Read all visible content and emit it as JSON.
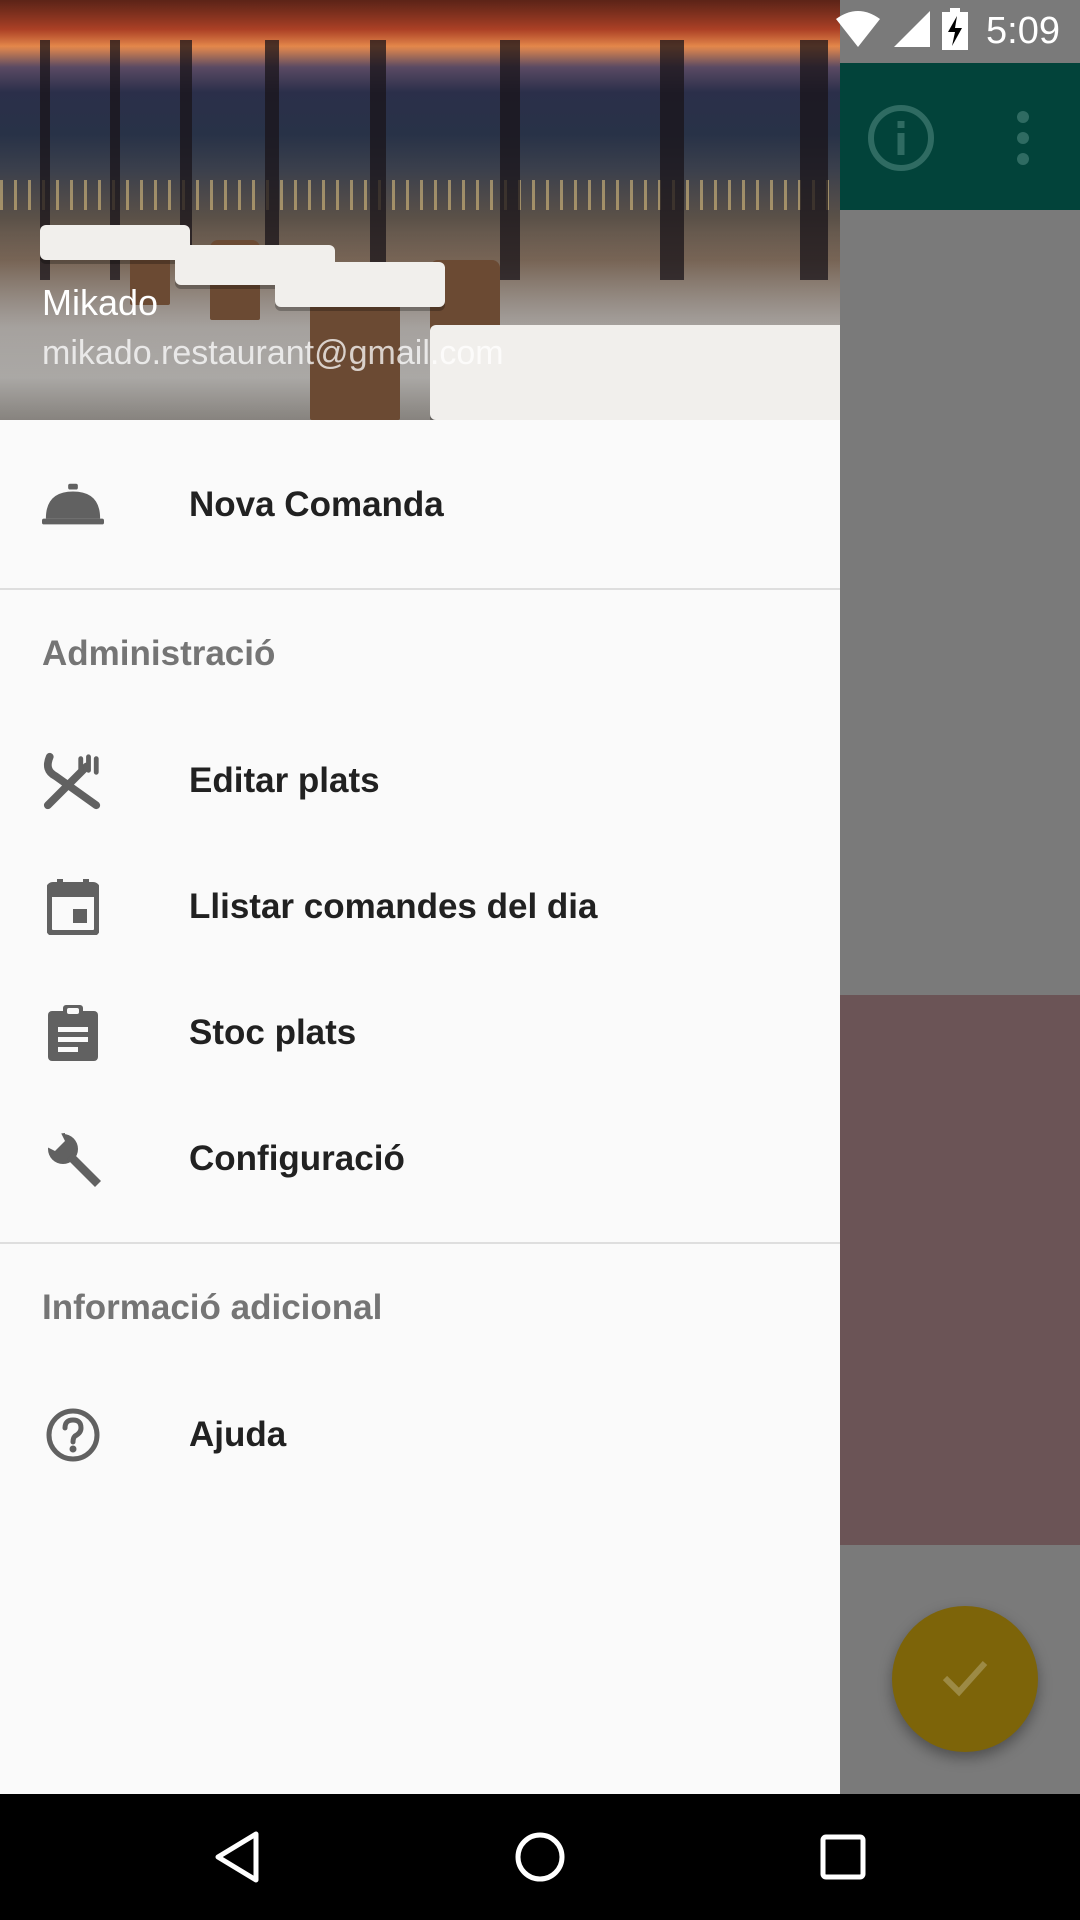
{
  "status_bar": {
    "time": "5:09"
  },
  "drawer": {
    "header": {
      "account_name": "Mikado",
      "account_email": "mikado.restaurant@gmail.com"
    },
    "primary_item": {
      "label": "Nova Comanda",
      "icon": "room-service-icon"
    },
    "sections": [
      {
        "title": "Administració",
        "items": [
          {
            "label": "Editar plats",
            "icon": "utensils-crossed-icon"
          },
          {
            "label": "Llistar comandes del dia",
            "icon": "calendar-today-icon"
          },
          {
            "label": "Stoc plats",
            "icon": "clipboard-icon"
          },
          {
            "label": "Configuració",
            "icon": "wrench-icon"
          }
        ]
      },
      {
        "title": "Informació adicional",
        "items": [
          {
            "label": "Ajuda",
            "icon": "help-circle-icon"
          }
        ]
      }
    ]
  },
  "background_app": {
    "toolbar_actions": [
      "info-icon",
      "more-vert-icon"
    ],
    "fab_icon": "check-icon"
  },
  "colors": {
    "toolbar": "#02433a",
    "fab": "#7d6409",
    "drawer_bg": "#fafafa",
    "section_title": "#757575"
  }
}
